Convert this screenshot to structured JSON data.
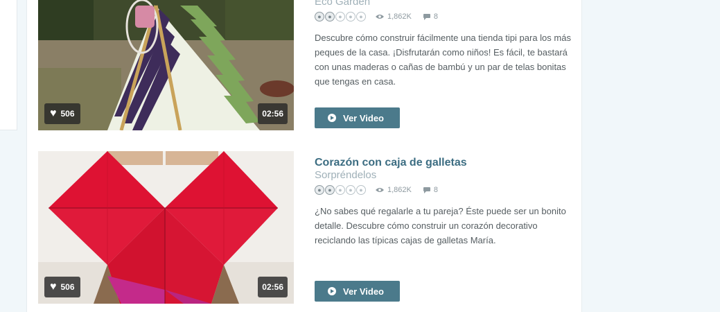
{
  "videos": [
    {
      "title": "",
      "category": "Eco Garden",
      "rating": 2,
      "rating_max": 5,
      "views": "1,862K",
      "comments": "8",
      "description": "Descubre cómo construir fácilmente una tienda tipi para los más peques de la casa. ¡Disfrutarán como niños! Es fácil, te bastará con unas maderas o cañas de bambú y un par de telas bonitas que tengas en casa.",
      "likes": "506",
      "duration": "02:56",
      "button_label": "Ver Video",
      "thumbnail_icon": "tipi-tent-image"
    },
    {
      "title": "Corazón con caja de galletas",
      "category": "Sorpréndelos",
      "rating": 2,
      "rating_max": 5,
      "views": "1,862K",
      "comments": "8",
      "description": "¿No sabes qué regalarle a tu pareja? Éste puede ser un bonito detalle. Descubre cómo construir un corazón decorativo reciclando las típicas cajas de galletas María.",
      "likes": "506",
      "duration": "02:56",
      "button_label": "Ver Video",
      "thumbnail_icon": "cardboard-heart-image"
    }
  ],
  "colors": {
    "title": "#3c6d82",
    "category": "#9fb0b8",
    "button": "#4b7a8b",
    "page_background": "#f1f7fa"
  },
  "icons": {
    "rating": "lightbulb-icon",
    "views": "eye-icon",
    "comments": "comment-icon",
    "likes": "heart-icon",
    "play": "play-circle-icon"
  }
}
